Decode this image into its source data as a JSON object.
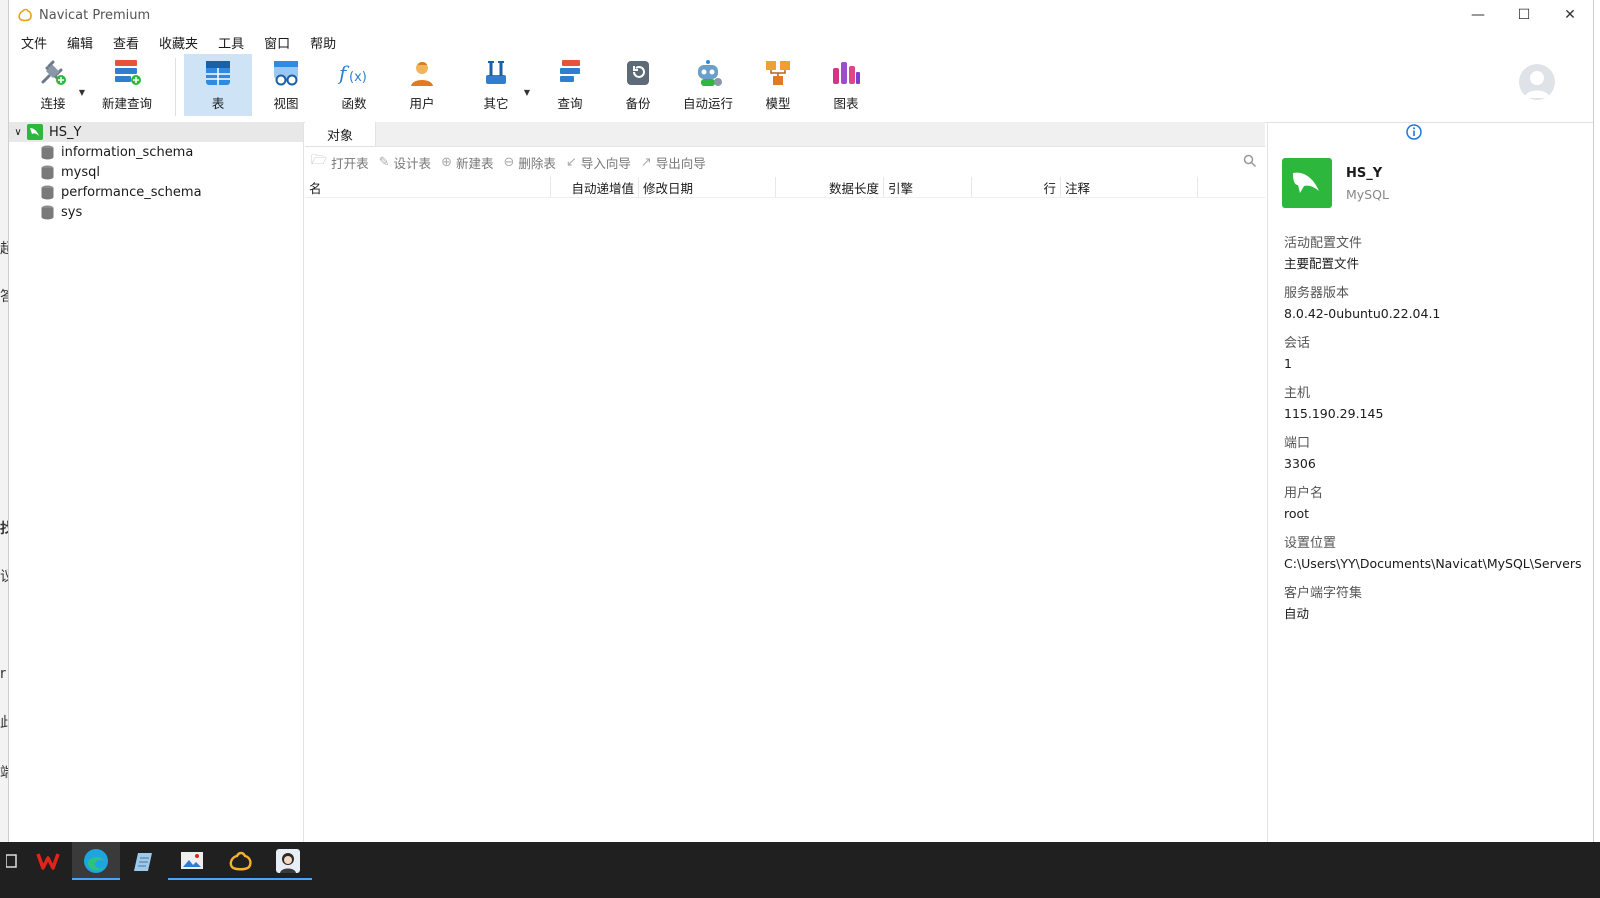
{
  "window": {
    "title": "Navicat Premium"
  },
  "menu": [
    "文件",
    "编辑",
    "查看",
    "收藏夹",
    "工具",
    "窗口",
    "帮助"
  ],
  "toolbar": {
    "connect": "连接",
    "new_query": "新建查询",
    "table": "表",
    "view": "视图",
    "function": "函数",
    "user": "用户",
    "other": "其它",
    "query": "查询",
    "backup": "备份",
    "automation": "自动运行",
    "model": "模型",
    "chart": "图表"
  },
  "tree": {
    "root": "HS_Y",
    "databases": [
      "information_schema",
      "mysql",
      "performance_schema",
      "sys"
    ]
  },
  "tabs": {
    "objects": "对象"
  },
  "object_toolbar": {
    "open_table": "打开表",
    "design_table": "设计表",
    "new_table": "新建表",
    "delete_table": "删除表",
    "import_wizard": "导入向导",
    "export_wizard": "导出向导"
  },
  "grid_columns": {
    "name": "名",
    "auto_increment": "自动递增值",
    "modified_date": "修改日期",
    "data_length": "数据长度",
    "engine": "引擎",
    "rows": "行",
    "comment": "注释"
  },
  "info": {
    "name": "HS_Y",
    "type": "MySQL",
    "fields": [
      {
        "k": "活动配置文件",
        "v": "主要配置文件"
      },
      {
        "k": "服务器版本",
        "v": "8.0.42-0ubuntu0.22.04.1"
      },
      {
        "k": "会话",
        "v": "1"
      },
      {
        "k": "主机",
        "v": "115.190.29.145"
      },
      {
        "k": "端口",
        "v": "3306"
      },
      {
        "k": "用户名",
        "v": "root"
      },
      {
        "k": "设置位置",
        "v": "C:\\Users\\YY\\Documents\\Navicat\\MySQL\\Servers"
      },
      {
        "k": "客户端字符集",
        "v": "自动"
      }
    ]
  },
  "behind_glyphs": [
    "超",
    "答",
    "找",
    "议",
    "r",
    "此",
    "端"
  ],
  "colors": {
    "accent": "#cfe3f6",
    "mysql_green": "#2db83d",
    "taskbar": "#202020"
  }
}
